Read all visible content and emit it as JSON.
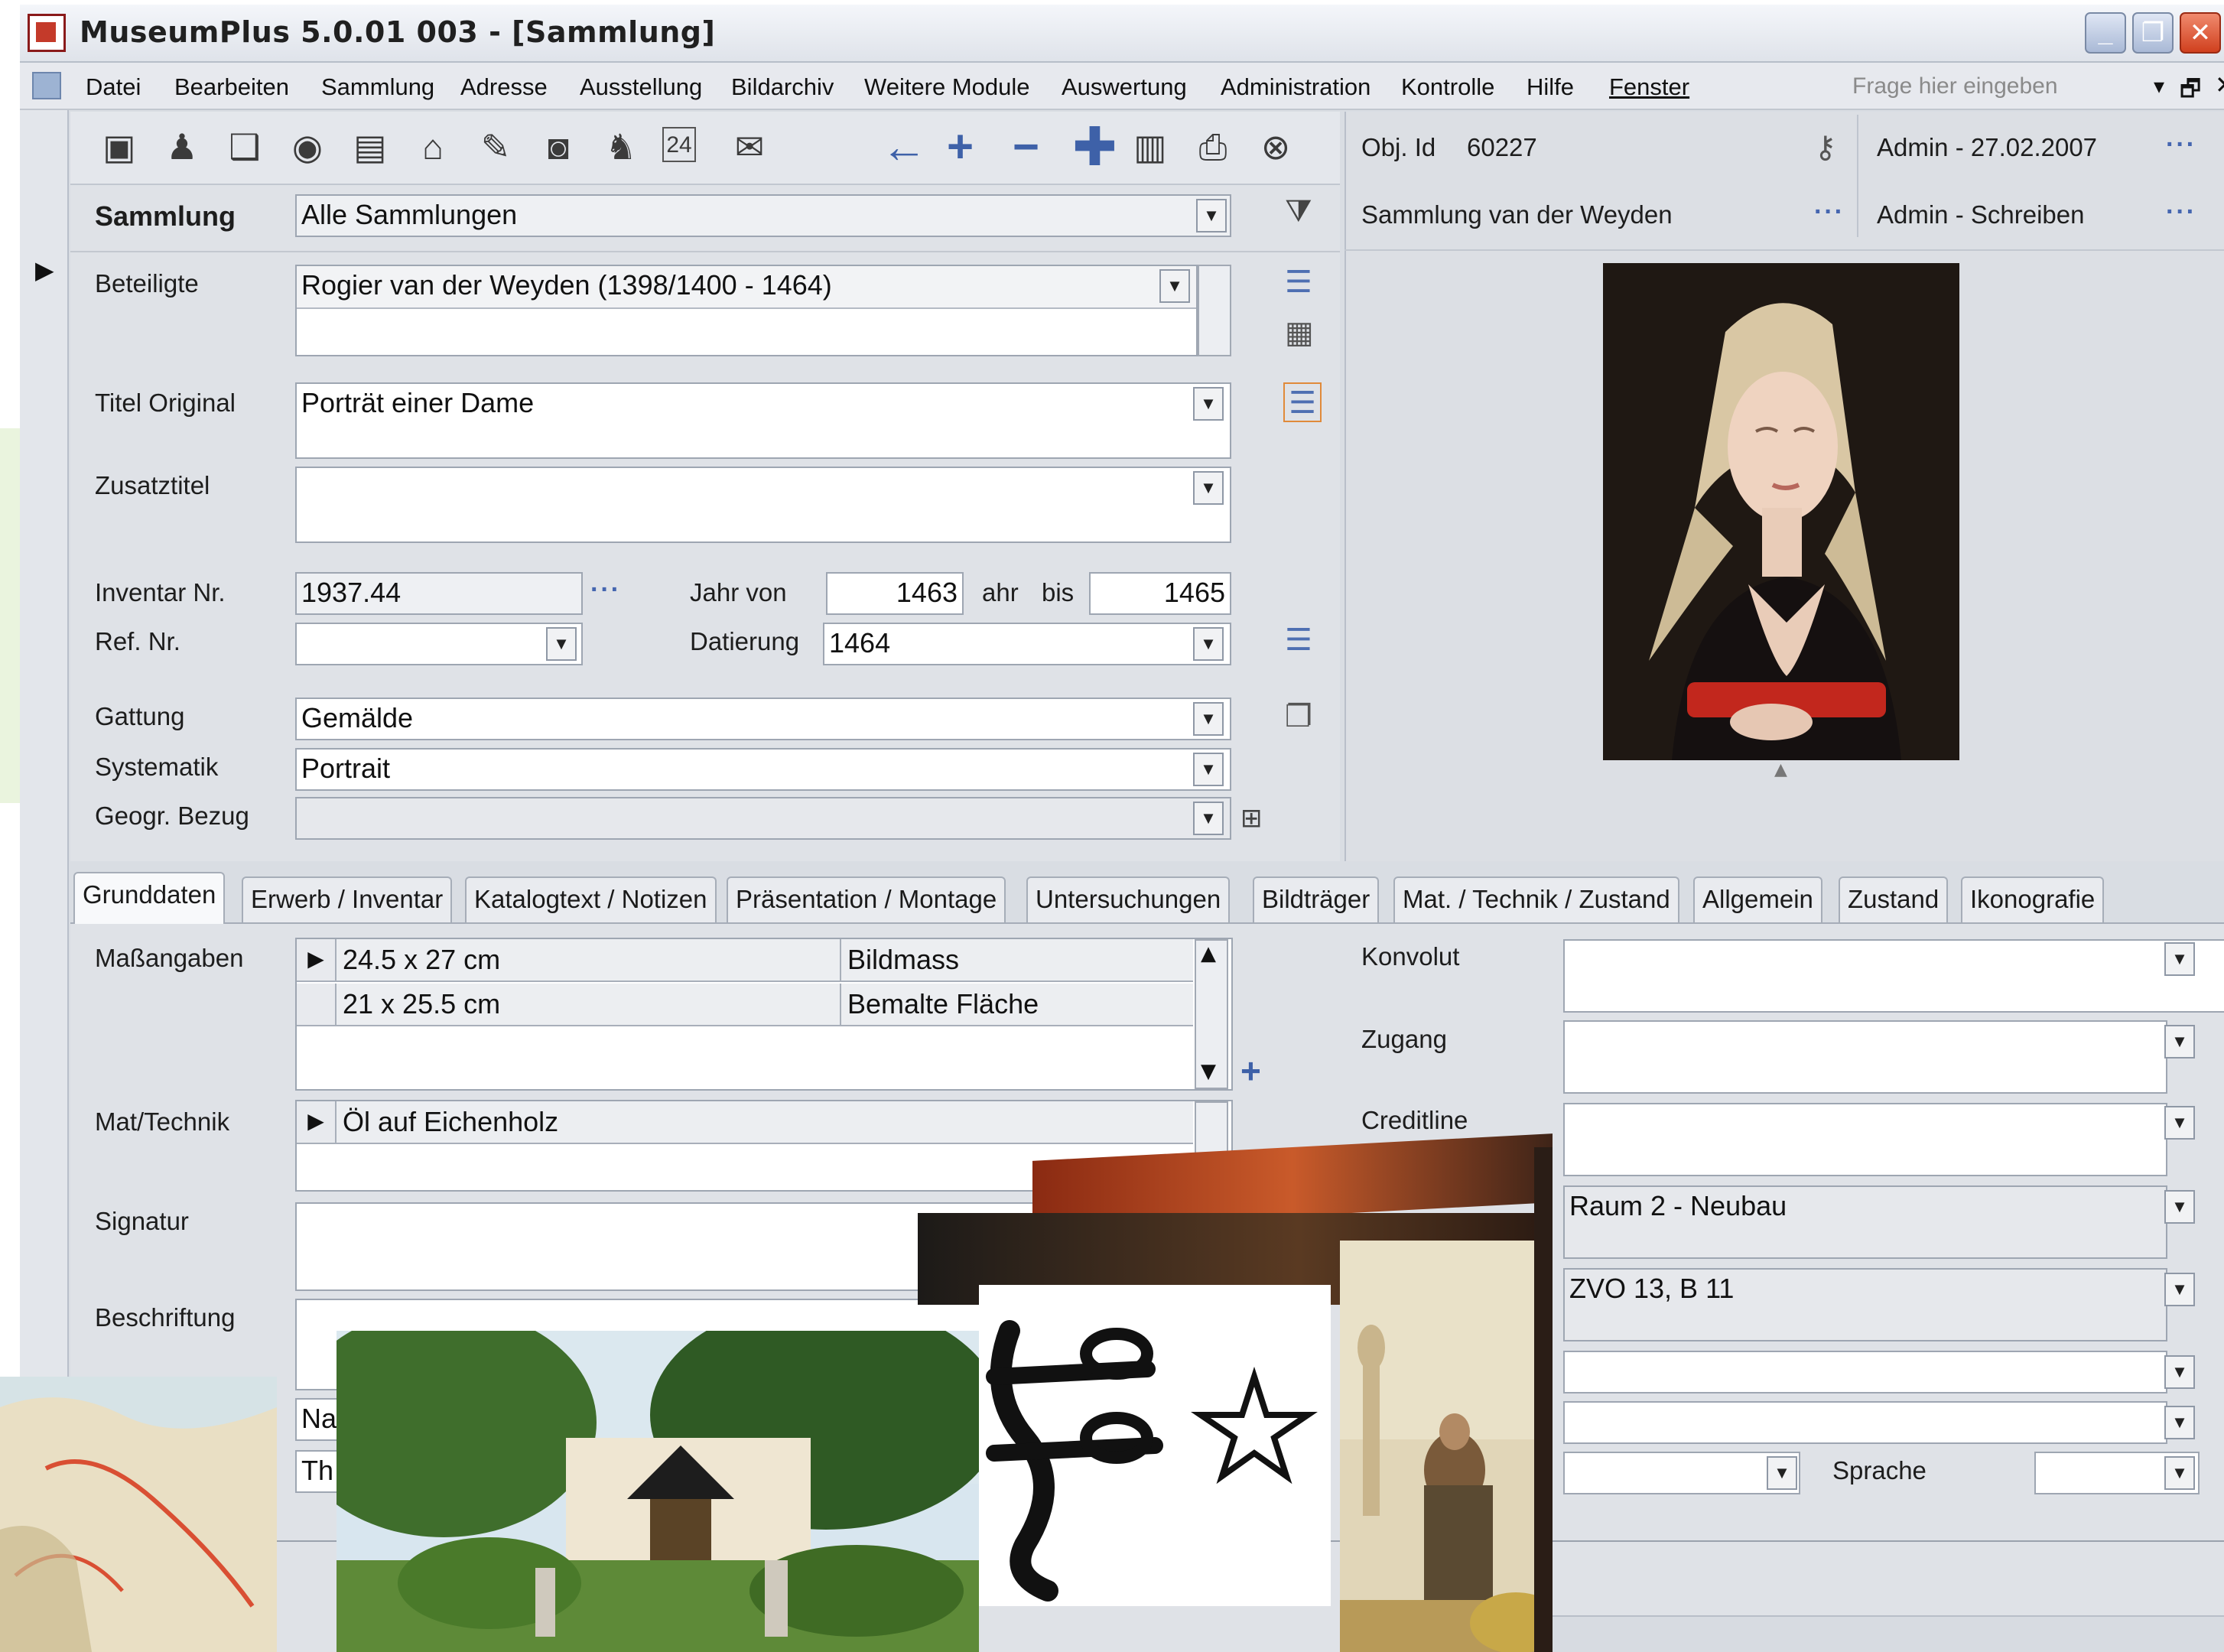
{
  "window": {
    "title": "MuseumPlus 5.0.01 003 - [Sammlung]"
  },
  "menubar": {
    "items": [
      "Datei",
      "Bearbeiten",
      "Sammlung",
      "Adresse",
      "Ausstellung",
      "Bildarchiv",
      "Weitere Module",
      "Auswertung",
      "Administration",
      "Kontrolle",
      "Hilfe",
      "Fenster"
    ],
    "help_placeholder": "Frage hier eingeben"
  },
  "header": {
    "obj_id_label": "Obj. Id",
    "obj_id_value": "60227",
    "admin_date": "Admin - 27.02.2007",
    "sammlung_label": "Sammlung",
    "sammlung_value": "Alle Sammlungen",
    "collection_name": "Sammlung van der Weyden",
    "admin_mode": "Admin - Schreiben"
  },
  "form": {
    "beteiligte_label": "Beteiligte",
    "beteiligte_value": "Rogier van der Weyden (1398/1400 - 1464)",
    "titel_label": "Titel Original",
    "titel_value": "Porträt einer Dame",
    "zusatz_label": "Zusatztitel",
    "inventar_label": "Inventar Nr.",
    "inventar_value": "1937.44",
    "jahr_von_label": "Jahr von",
    "jahr_von_value": "1463",
    "jahr_suffix": "ahr",
    "bis_label": "bis",
    "bis_value": "1465",
    "ref_label": "Ref. Nr.",
    "datierung_label": "Datierung",
    "datierung_value": "1464",
    "gattung_label": "Gattung",
    "gattung_value": "Gemälde",
    "systematik_label": "Systematik",
    "systematik_value": "Portrait",
    "geogr_label": "Geogr. Bezug"
  },
  "tabs": [
    "Grunddaten",
    "Erwerb / Inventar",
    "Katalogtext / Notizen",
    "Präsentation / Montage",
    "Untersuchungen",
    "Bildträger",
    "Mat. / Technik / Zustand",
    "Allgemein",
    "Zustand",
    "Ikonografie"
  ],
  "grunddaten": {
    "masse_label": "Maßangaben",
    "masse_rows": [
      {
        "value": "24.5 x 27 cm",
        "type": "Bildmass"
      },
      {
        "value": "21 x 25.5 cm",
        "type": "Bemalte Fläche"
      }
    ],
    "mat_label": "Mat/Technik",
    "mat_value": "Öl auf Eichenholz",
    "signatur_label": "Signatur",
    "beschriftung_label": "Beschriftung",
    "partial_1": "Na",
    "partial_2": "Th"
  },
  "right_panel": {
    "konvolut_label": "Konvolut",
    "zugang_label": "Zugang",
    "creditline_label": "Creditline",
    "standort_value": "Raum 2 - Neubau",
    "standort2_value": "ZVO 13, B 11",
    "sprache_label": "Sprache"
  },
  "icons": {
    "toolbar": [
      "object-icon",
      "person-icon",
      "books-icon",
      "eye-icon",
      "document-icon",
      "house-icon",
      "chart-icon",
      "camera-icon",
      "group-icon",
      "calendar-icon",
      "envelope-icon"
    ],
    "nav": [
      "back-arrow-icon",
      "add-icon",
      "remove-icon",
      "add-bold-icon",
      "list-icon",
      "print-icon",
      "binoculars-icon"
    ]
  }
}
